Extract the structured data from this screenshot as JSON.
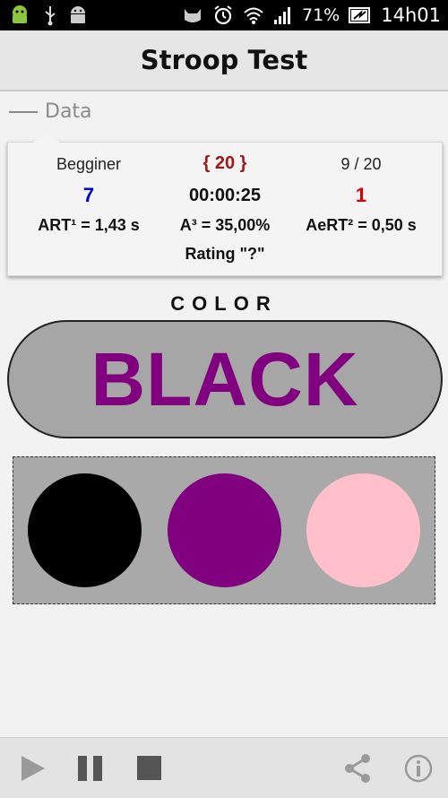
{
  "status_bar": {
    "battery_percent": "71%",
    "clock": "14h01",
    "icons_left": [
      "android-robot-icon",
      "usb-icon",
      "android-debug-icon"
    ],
    "icons_right": [
      "cat-icon",
      "alarm-icon",
      "wifi-icon",
      "signal-icon",
      "battery-charging-icon"
    ]
  },
  "action_bar": {
    "title": "Stroop Test"
  },
  "section": {
    "title": "Data"
  },
  "data": {
    "level": "Begginer",
    "target": "{ 20 }",
    "progress": "9 / 20",
    "correct_count": "7",
    "timer": "00:00:25",
    "wrong_count": "1",
    "art": "ART¹ = 1,43 s",
    "accuracy": "A³ = 35,00%",
    "aert": "AeRT² = 0,50 s",
    "rating": "Rating \"?\""
  },
  "colors": {
    "correct_count": "#0000cc",
    "target": "#a01818",
    "wrong_count": "#dd0000"
  },
  "stimulus": {
    "label": "COLOR",
    "word": "BLACK",
    "word_color": "#800080"
  },
  "choices": [
    {
      "name": "black",
      "color": "#000000"
    },
    {
      "name": "purple",
      "color": "#800080"
    },
    {
      "name": "pink",
      "color": "#ffc0cb"
    }
  ],
  "bottom_bar": {
    "buttons": [
      "play-icon",
      "pause-icon",
      "stop-icon",
      "share-icon",
      "info-icon"
    ]
  }
}
